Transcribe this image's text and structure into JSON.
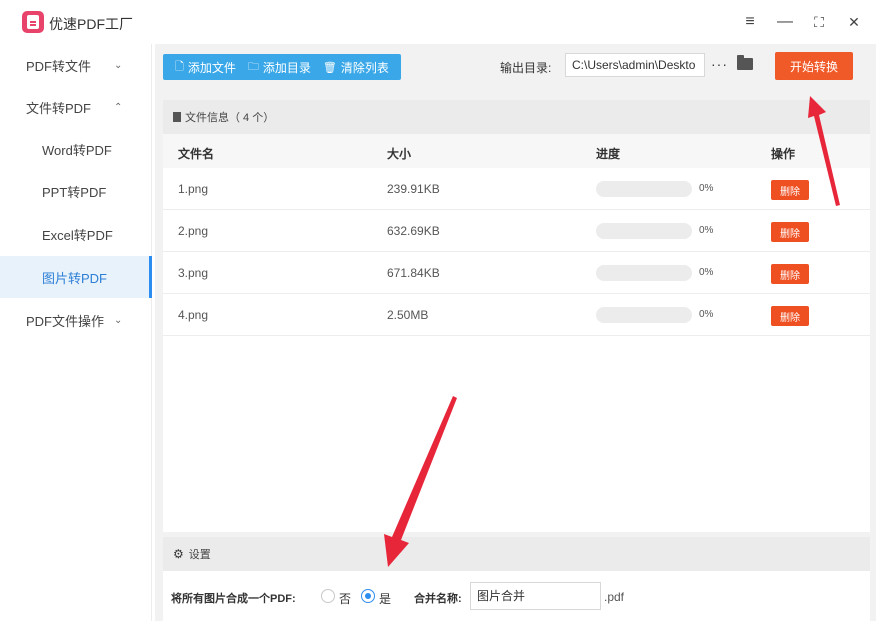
{
  "app": {
    "title": "优速PDF工厂"
  },
  "window_controls": {
    "menu": "≡",
    "minimize": "—",
    "maximize": "⛶",
    "close": "✕"
  },
  "sidebar": {
    "items": [
      {
        "label": "PDF转文件",
        "chevron": "⌄"
      },
      {
        "label": "文件转PDF",
        "chevron": "⌃"
      },
      {
        "label": "Word转PDF"
      },
      {
        "label": "PPT转PDF"
      },
      {
        "label": "Excel转PDF"
      },
      {
        "label": "图片转PDF",
        "active": true
      },
      {
        "label": "PDF文件操作",
        "chevron": "⌄"
      }
    ]
  },
  "toolbar": {
    "add_file": "添加文件",
    "add_dir": "添加目录",
    "clear_list": "清除列表",
    "output_label": "输出目录:",
    "output_path": "C:\\Users\\admin\\Deskto",
    "more": "···",
    "start": "开始转换"
  },
  "file_panel": {
    "header": "文件信息（ 4 个）",
    "columns": {
      "name": "文件名",
      "size": "大小",
      "progress": "进度",
      "action": "操作"
    },
    "rows": [
      {
        "name": "1.png",
        "size": "239.91KB",
        "progress": 0,
        "pct": "0%",
        "action": "删除"
      },
      {
        "name": "2.png",
        "size": "632.69KB",
        "progress": 0,
        "pct": "0%",
        "action": "删除"
      },
      {
        "name": "3.png",
        "size": "671.84KB",
        "progress": 0,
        "pct": "0%",
        "action": "删除"
      },
      {
        "name": "4.png",
        "size": "2.50MB",
        "progress": 0,
        "pct": "0%",
        "action": "删除"
      }
    ]
  },
  "settings": {
    "header": "设置",
    "merge_label": "将所有图片合成一个PDF:",
    "option_no": "否",
    "option_yes": "是",
    "selected": "是",
    "name_label": "合并名称:",
    "name_value": "图片合并",
    "ext": ".pdf"
  },
  "colors": {
    "toolbar_blue": "#3aa8e8",
    "start_orange": "#f05a28",
    "delete_orange": "#ee5022",
    "annotation_red": "#e8263a",
    "accent": "#2d8cf0"
  }
}
